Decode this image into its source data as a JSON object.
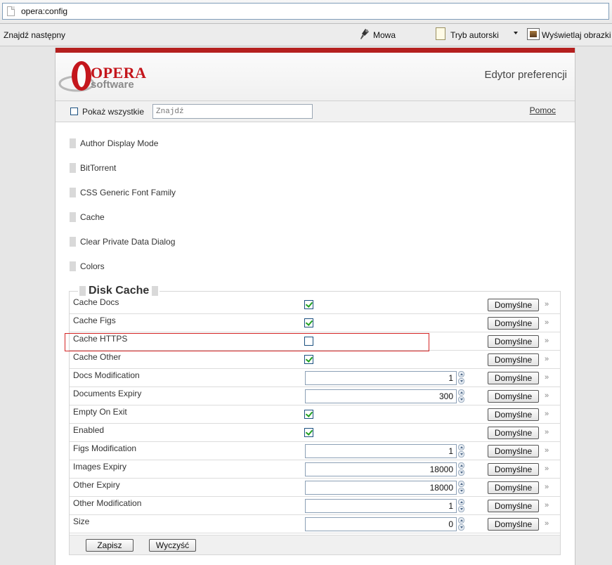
{
  "address_bar": {
    "url": "opera:config"
  },
  "toolbar": {
    "find_next": "Znajdź następny",
    "speech": "Mowa",
    "author_mode": "Tryb autorski",
    "show_images": "Wyświetlaj obrazki"
  },
  "header": {
    "brand_name": "OPERA",
    "brand_sub": "software",
    "title": "Edytor preferencji"
  },
  "search": {
    "show_all_label": "Pokaż wszystkie",
    "show_all_checked": false,
    "find_placeholder": "Znajdź",
    "help": "Pomoc"
  },
  "sections": [
    "Author Display Mode",
    "BitTorrent",
    "CSS Generic Font Family",
    "Cache",
    "Clear Private Data Dialog",
    "Colors"
  ],
  "disk_cache": {
    "title": "Disk Cache",
    "default_label": "Domyślne",
    "prefs": [
      {
        "name": "Cache Docs",
        "type": "checkbox",
        "checked": true
      },
      {
        "name": "Cache Figs",
        "type": "checkbox",
        "checked": true
      },
      {
        "name": "Cache HTTPS",
        "type": "checkbox",
        "checked": false
      },
      {
        "name": "Cache Other",
        "type": "checkbox",
        "checked": true
      },
      {
        "name": "Docs Modification",
        "type": "number",
        "value": "1"
      },
      {
        "name": "Documents Expiry",
        "type": "number",
        "value": "300"
      },
      {
        "name": "Empty On Exit",
        "type": "checkbox",
        "checked": true
      },
      {
        "name": "Enabled",
        "type": "checkbox",
        "checked": true
      },
      {
        "name": "Figs Modification",
        "type": "number",
        "value": "1"
      },
      {
        "name": "Images Expiry",
        "type": "number",
        "value": "18000"
      },
      {
        "name": "Other Expiry",
        "type": "number",
        "value": "18000"
      },
      {
        "name": "Other Modification",
        "type": "number",
        "value": "1"
      },
      {
        "name": "Size",
        "type": "number",
        "value": "0"
      }
    ],
    "save": "Zapisz",
    "clear": "Wyczyść"
  },
  "colors": {
    "brand_red": "#b5201f",
    "check_green": "#21a121",
    "highlight_red": "#d42525"
  }
}
